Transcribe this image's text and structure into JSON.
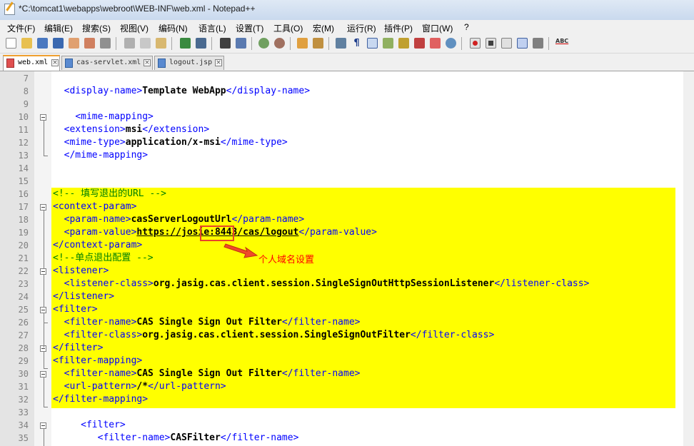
{
  "window": {
    "title": "*C:\\tomcat1\\webapps\\webroot\\WEB-INF\\web.xml - Notepad++"
  },
  "menu": [
    "文件(F)",
    "编辑(E)",
    "搜索(S)",
    "视图(V)",
    "编码(N)",
    "语言(L)",
    "设置(T)",
    "工具(O)",
    "宏(M)",
    "运行(R)",
    "插件(P)",
    "窗口(W)",
    "?"
  ],
  "toolbar": {
    "spell_label": "ABC"
  },
  "tabs": [
    {
      "label": "web.xml",
      "active": true
    },
    {
      "label": "cas-servlet.xml",
      "active": false
    },
    {
      "label": "logout.jsp",
      "active": false
    }
  ],
  "editor": {
    "lines": [
      {
        "n": "7",
        "text": ""
      },
      {
        "n": "8",
        "text": "  <display-name>Template WebApp</display-name>"
      },
      {
        "n": "9",
        "text": ""
      },
      {
        "n": "10",
        "text": "    <mime-mapping>"
      },
      {
        "n": "11",
        "text": "  <extension>msi</extension>"
      },
      {
        "n": "12",
        "text": "  <mime-type>application/x-msi</mime-type>"
      },
      {
        "n": "13",
        "text": "  </mime-mapping>"
      },
      {
        "n": "14",
        "text": ""
      },
      {
        "n": "15",
        "text": ""
      },
      {
        "n": "16",
        "text": "<!-- 填写退出的URL -->"
      },
      {
        "n": "17",
        "text": "<context-param>"
      },
      {
        "n": "18",
        "text": "  <param-name>casServerLogoutUrl</param-name>"
      },
      {
        "n": "19",
        "text": "  <param-value>https://josie:8443/cas/logout</param-value>"
      },
      {
        "n": "20",
        "text": "</context-param>"
      },
      {
        "n": "21",
        "text": "<!--单点退出配置 -->"
      },
      {
        "n": "22",
        "text": "<listener>"
      },
      {
        "n": "23",
        "text": "  <listener-class>org.jasig.cas.client.session.SingleSignOutHttpSessionListener</listener-class>"
      },
      {
        "n": "24",
        "text": "</listener>"
      },
      {
        "n": "25",
        "text": "<filter>"
      },
      {
        "n": "26",
        "text": "  <filter-name>CAS Single Sign Out Filter</filter-name>"
      },
      {
        "n": "27",
        "text": "  <filter-class>org.jasig.cas.client.session.SingleSignOutFilter</filter-class>"
      },
      {
        "n": "28",
        "text": "</filter>"
      },
      {
        "n": "29",
        "text": "<filter-mapping>"
      },
      {
        "n": "30",
        "text": "  <filter-name>CAS Single Sign Out Filter</filter-name>"
      },
      {
        "n": "31",
        "text": "  <url-pattern>/*</url-pattern>"
      },
      {
        "n": "32",
        "text": "</filter-mapping>"
      },
      {
        "n": "33",
        "text": ""
      },
      {
        "n": "34",
        "text": "     <filter>"
      },
      {
        "n": "35",
        "text": "        <filter-name>CASFilter</filter-name>"
      }
    ]
  },
  "annotation": {
    "text": "个人域名设置",
    "color": "#ff0000"
  },
  "colors": {
    "highlight": "#ffff00",
    "tag": "#0000ff",
    "comment": "#008000",
    "annotation_box": "#e8442a"
  }
}
